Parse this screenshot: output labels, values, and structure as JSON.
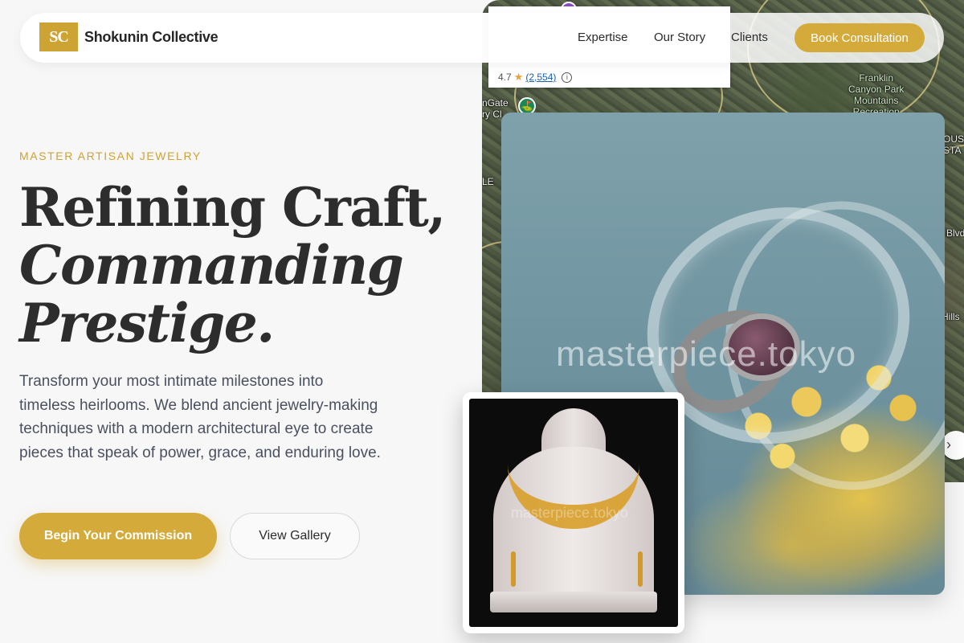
{
  "nav": {
    "logo_mark": "SC",
    "brand": "Shokunin Collective",
    "links": [
      "Expertise",
      "Our Story",
      "Clients"
    ],
    "cta": "Book Consultation"
  },
  "hero": {
    "eyebrow": "MASTER ARTISAN JEWELRY",
    "headline_line1": "Refining Craft,",
    "headline_line2": "Commanding",
    "headline_line3": "Prestige.",
    "lead": "Transform your most intimate milestones into timeless heirlooms. We blend ancient jewelry-making techniques with a modern architectural eye to create pieces that speak of power, grace, and enduring love.",
    "primary_button": "Begin Your Commission",
    "secondary_button": "View Gallery"
  },
  "media": {
    "main_watermark": "masterpiece.tokyo",
    "inset_watermark": "masterpiece.tokyo"
  },
  "map": {
    "rating": "4.7",
    "review_count": "(2,554)",
    "labels": {
      "park": "Franklin\nCanyon Park\nMountains\nRecreation",
      "golf": "nGate\nry Cl",
      "left_edge": "LE",
      "hills": "Hills",
      "blvd": "Blvd",
      "house": "OUS\nSTA"
    }
  },
  "colors": {
    "accent_gold": "#d4aa3a",
    "eyebrow_gold": "#cfa235",
    "body_text": "#4a5060",
    "page_bg": "#f7f7f7"
  },
  "icons": [
    "star-icon",
    "info-icon",
    "chevron-right-icon",
    "map-pin-icon"
  ]
}
